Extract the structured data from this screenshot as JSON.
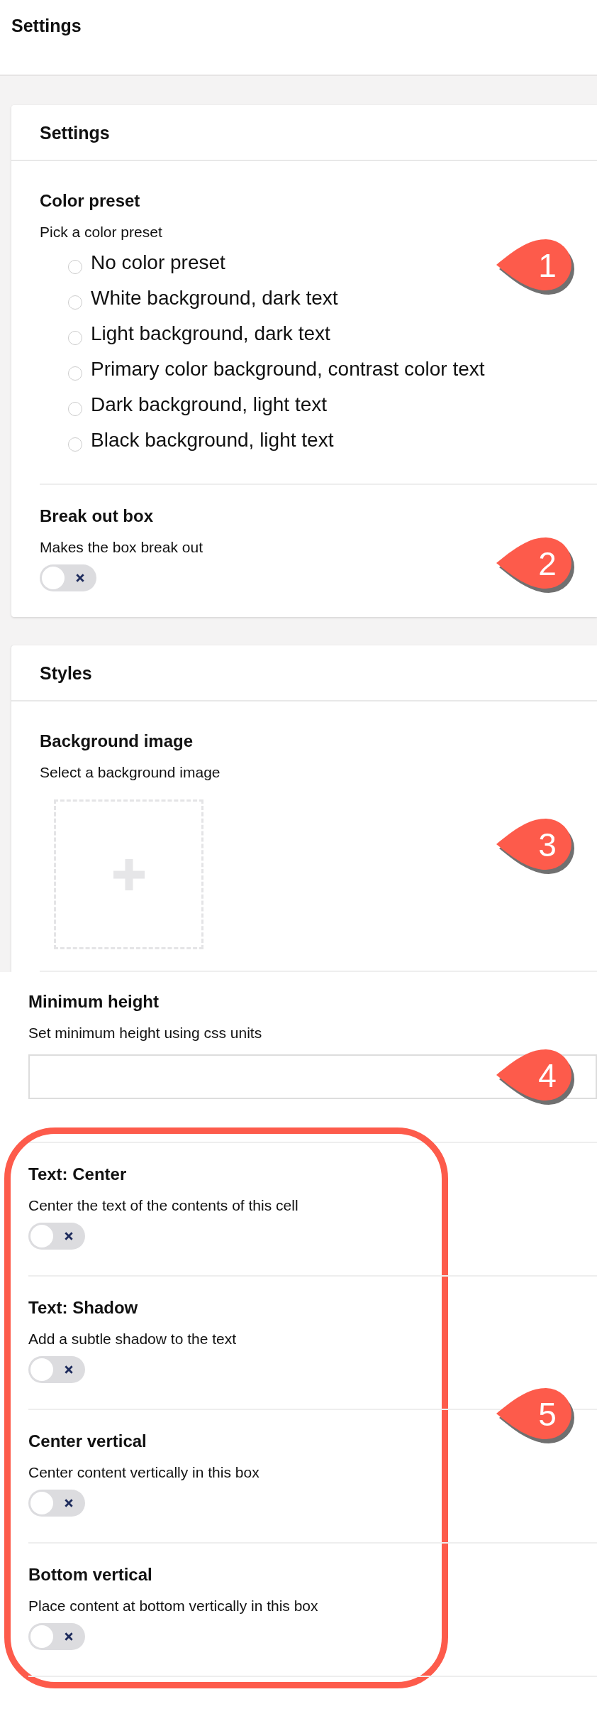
{
  "header": {
    "title": "Settings"
  },
  "panels": [
    {
      "title": "Settings",
      "fields": [
        {
          "kind": "radio",
          "label": "Color preset",
          "description": "Pick a color preset",
          "callout": "1",
          "options": [
            {
              "label": "No color preset",
              "selected": false
            },
            {
              "label": "White background, dark text",
              "selected": false
            },
            {
              "label": "Light background, dark text",
              "selected": false
            },
            {
              "label": "Primary color background, contrast color text",
              "selected": false
            },
            {
              "label": "Dark background, light text",
              "selected": false
            },
            {
              "label": "Black background, light text",
              "selected": false
            }
          ]
        },
        {
          "kind": "toggle",
          "label": "Break out box",
          "description": "Makes the box break out",
          "on": false,
          "callout": "2"
        }
      ]
    },
    {
      "title": "Styles",
      "fields": [
        {
          "kind": "image",
          "label": "Background image",
          "description": "Select a background image",
          "callout": "3"
        }
      ]
    }
  ],
  "extra_fields": [
    {
      "kind": "text",
      "label": "Minimum height",
      "description": "Set minimum height using css units",
      "callout": "4"
    }
  ],
  "highlighted_group": {
    "callout": "5",
    "fields": [
      {
        "kind": "toggle",
        "label": "Text: Center",
        "description": "Center the text of the contents of this cell",
        "on": false
      },
      {
        "kind": "toggle",
        "label": "Text: Shadow",
        "description": "Add a subtle shadow to the text",
        "on": false
      },
      {
        "kind": "toggle",
        "label": "Center vertical",
        "description": "Center content vertically in this box",
        "on": false
      },
      {
        "kind": "toggle",
        "label": "Bottom vertical",
        "description": "Place content at bottom vertically in this box",
        "on": false
      }
    ]
  }
}
